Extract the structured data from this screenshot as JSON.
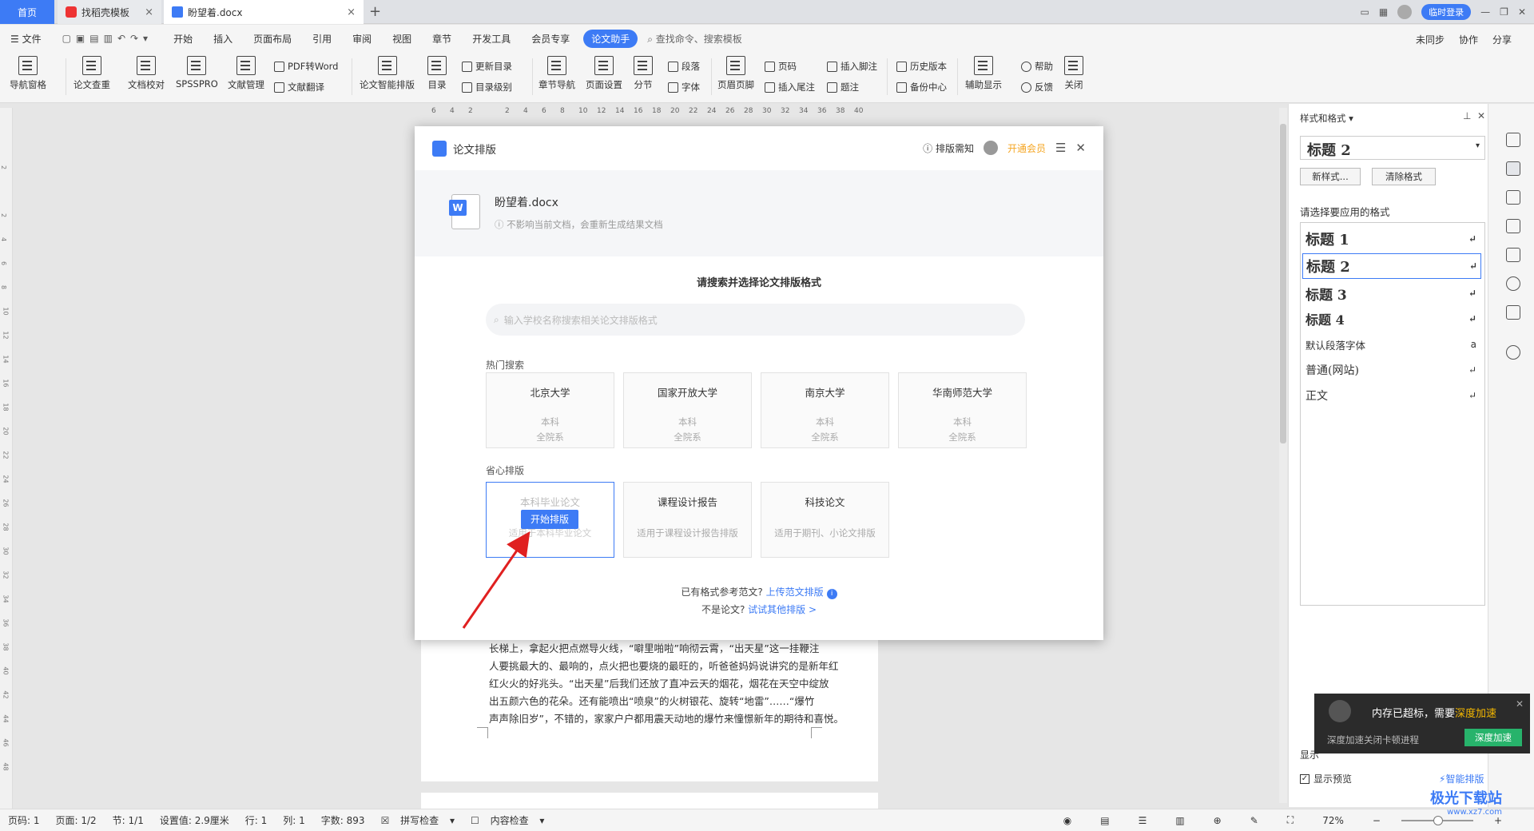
{
  "tabs": {
    "home": "首页",
    "template": "找稻壳模板",
    "doc": "盼望着.docx",
    "plus": "+",
    "close": "×"
  },
  "topright": {
    "login": "临时登录"
  },
  "menu": {
    "file": "文件",
    "items": [
      "开始",
      "插入",
      "页面布局",
      "引用",
      "审阅",
      "视图",
      "章节",
      "开发工具",
      "会员专享"
    ],
    "active": "论文助手",
    "search": "查找命令、搜索模板",
    "right": [
      "未同步",
      "协作",
      "分享"
    ]
  },
  "ribbon": {
    "nav": "导航窗格",
    "check": "论文查重",
    "proof": "文档校对",
    "spss": "SPSSPRO",
    "docmgr": "文献管理",
    "pdf2word": "PDF转Word",
    "translate": "文献翻译",
    "smartformat": "论文智能排版",
    "toc": "目录",
    "update_toc": "更新目录",
    "toc_level": "目录级别",
    "chapter_nav": "章节导航",
    "page_setup": "页面设置",
    "section": "分节",
    "paragraph": "段落",
    "font": "字体",
    "header_footer": "页眉页脚",
    "page_num": "页码",
    "insert_footnote": "插入脚注",
    "insert_endnote": "插入尾注",
    "caption": "题注",
    "history": "历史版本",
    "backup": "备份中心",
    "assist": "辅助显示",
    "help": "帮助",
    "feedback": "反馈",
    "close": "关闭"
  },
  "ruler": [
    "6",
    "4",
    "2",
    "",
    "2",
    "4",
    "6",
    "8",
    "10",
    "12",
    "14",
    "16",
    "18",
    "20",
    "22",
    "24",
    "26",
    "28",
    "30",
    "32",
    "34",
    "36",
    "38",
    "40"
  ],
  "ruler_left": [
    "2",
    "",
    "2",
    "4",
    "6",
    "8",
    "10",
    "12",
    "14",
    "16",
    "18",
    "20",
    "22",
    "24",
    "26",
    "28",
    "30",
    "32",
    "34",
    "36",
    "38",
    "40",
    "42",
    "44",
    "46",
    "48"
  ],
  "doc_lines": [
    "长梯上，拿起火把点燃导火线，“噼里啪啦”响彻云霄，“出天星”这一挂鞭注",
    "人要挑最大的、最响的，点火把也要烧的最旺的，听爸爸妈妈说讲究的是新年红",
    "红火火的好兆头。“出天星”后我们还放了直冲云天的烟花，烟花在天空中绽放",
    "出五颜六色的花朵。还有能喷出“喷泉”的火树银花、旋转“地雷”……“爆竹",
    "声声除旧岁”，不错的，家家户户都用震天动地的爆竹来憧憬新年的期待和喜悦。"
  ],
  "modal": {
    "title": "论文排版",
    "needs": "排版需知",
    "vip": "开通会员",
    "file_name": "盼望着.docx",
    "file_note": "不影响当前文档，会重新生成结果文档",
    "subtitle": "请搜索并选择论文排版格式",
    "search_placeholder": "输入学校名称搜索相关论文排版格式",
    "hot_label": "热门搜索",
    "hot": [
      {
        "name": "北京大学",
        "l1": "本科",
        "l2": "全院系"
      },
      {
        "name": "国家开放大学",
        "l1": "本科",
        "l2": "全院系"
      },
      {
        "name": "南京大学",
        "l1": "本科",
        "l2": "全院系"
      },
      {
        "name": "华南师范大学",
        "l1": "本科",
        "l2": "全院系"
      }
    ],
    "easy_label": "省心排版",
    "easy": [
      {
        "name": "本科毕业论文",
        "desc": "适用于本科毕业论文",
        "button": "开始排版"
      },
      {
        "name": "课程设计报告",
        "desc": "适用于课程设计报告排版"
      },
      {
        "name": "科技论文",
        "desc": "适用于期刊、小论文排版"
      }
    ],
    "ref_q": "已有格式参考范文?",
    "ref_link": "上传范文排版",
    "not_q": "不是论文?",
    "not_link": "试试其他排版 >"
  },
  "panel": {
    "title": "样式和格式",
    "current": "标题 2",
    "new_style": "新样式...",
    "clear": "清除格式",
    "apply_label": "请选择要应用的格式",
    "styles": [
      "标题 1",
      "标题 2",
      "标题 3",
      "标题 4",
      "默认段落字体",
      "普通(网站)",
      "正文"
    ],
    "show_label": "显示",
    "preview": "显示预览",
    "smart": "智能排版"
  },
  "toast": {
    "text": "内存已超标，需要",
    "highlight": "深度加速",
    "sub": "深度加速关闭卡顿进程",
    "button": "深度加速"
  },
  "status": {
    "page": "页码: 1",
    "pages": "页面: 1/2",
    "section": "节: 1/1",
    "setting": "设置值: 2.9厘米",
    "row": "行: 1",
    "col": "列: 1",
    "words": "字数: 893",
    "spell": "拼写检查",
    "content": "内容检查",
    "zoom": "72%"
  },
  "watermark": {
    "name": "极光下载站",
    "url": "www.xz7.com"
  },
  "colors": {
    "accent": "#3d7bf5",
    "toast_btn": "#27b36b",
    "vip": "#f5a623"
  }
}
